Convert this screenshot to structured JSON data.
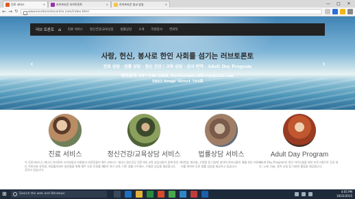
{
  "browser": {
    "tabs": [
      {
        "label": "진료 서비스",
        "fav_color": "#e05a28"
      },
      {
        "label": "라이프타운 러브토론토",
        "fav_color": "#9b2fae"
      },
      {
        "label": "라이프타운 설교 방송",
        "fav_color": "#f4c84a"
      }
    ],
    "url": "www.lovetorontocentre.com/index.html",
    "window_controls": [
      "—",
      "□",
      "✕"
    ]
  },
  "site": {
    "brand": "러브 토론토",
    "nav": [
      "진료 서비스",
      "정신건강/교육상담",
      "법률상담",
      "소개",
      "자원봉사",
      "연락처"
    ],
    "hero": {
      "title": "사랑, 헌신, 봉사로 한인 사회를 섬기는 러브토론토",
      "services": "진료 상담 · 법률 상담 · 정신 건강 / 교육 상담 · 공서 번역 · Adult Day Program",
      "contact_line1": "예약/문의: 647-348-5688, lovetoronto.office@gmail.com",
      "contact_line2": "5805 Yonge Street 704호"
    },
    "services": [
      {
        "title": "진료 서비스",
        "desc": "이 진료서비스는 캐나다 의사면허 소지자들과 자원봉사 의료진들이 한인 이민자와 유학생, 워킹홀리데이 청년들을 위해 매주 무료 진료를 제공하고 있습니다."
      },
      {
        "title": "정신건강/교육상담 서비스",
        "desc": "이 서비스는 캐나다 정신건강 전문가와 교육 상담사들이 함께 한인 가정의 자녀 교육, 이민 생활 스트레스, 우울증 상담을 제공합니다."
      },
      {
        "title": "법률상담 서비스",
        "desc": "이민법, 형사법, 가정법 등 다양한 분야의 변호사들이 매월 한인 커뮤니티를 위하여 무료 법률 상담을 제공하고 있습니다."
      },
      {
        "title": "Adult Day Program",
        "desc": "Adult Day Program은 한인 어르신들을 위한 프로그램으로 건강 체조, 노래, 미술, 영어 교실 등 다양한 활동을 제공합니다."
      }
    ]
  },
  "taskbar": {
    "search_placeholder": "Search the web and Windows",
    "time": "4:05 PM",
    "date": "10/22/2015"
  }
}
